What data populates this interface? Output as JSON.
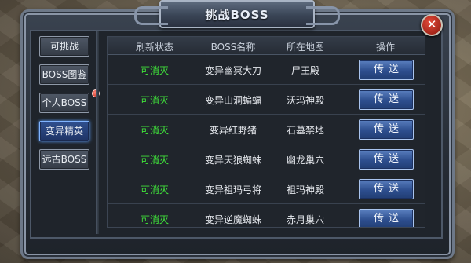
{
  "window": {
    "title": "挑战BOSS",
    "close_glyph": "✕"
  },
  "sidebar": {
    "items": [
      {
        "label": "可挑战",
        "active": false
      },
      {
        "label": "BOSS图鉴",
        "active": false
      },
      {
        "label": "个人BOSS",
        "active": false,
        "badge": true
      },
      {
        "label": "变异精英",
        "active": true
      },
      {
        "label": "远古BOSS",
        "active": false
      }
    ]
  },
  "table": {
    "headers": [
      "刷新状态",
      "BOSS名称",
      "所在地图",
      "操作"
    ],
    "rows": [
      {
        "status": "可消灭",
        "name": "变异幽冥大刀",
        "map": "尸王殿",
        "action": "传送"
      },
      {
        "status": "可消灭",
        "name": "变异山洞蝙蝠",
        "map": "沃玛神殿",
        "action": "传送"
      },
      {
        "status": "可消灭",
        "name": "变异红野猪",
        "map": "石墓禁地",
        "action": "传送"
      },
      {
        "status": "可消灭",
        "name": "变异天狼蜘蛛",
        "map": "幽龙巢穴",
        "action": "传送"
      },
      {
        "status": "可消灭",
        "name": "变异祖玛弓将",
        "map": "祖玛神殿",
        "action": "传送"
      },
      {
        "status": "可消灭",
        "name": "变异逆魔蜘蛛",
        "map": "赤月巢穴",
        "action": "传送"
      }
    ]
  },
  "colors": {
    "status_green": "#3fe03a",
    "active_blue": "#5fa0ff",
    "accent_red": "#c2180c"
  }
}
